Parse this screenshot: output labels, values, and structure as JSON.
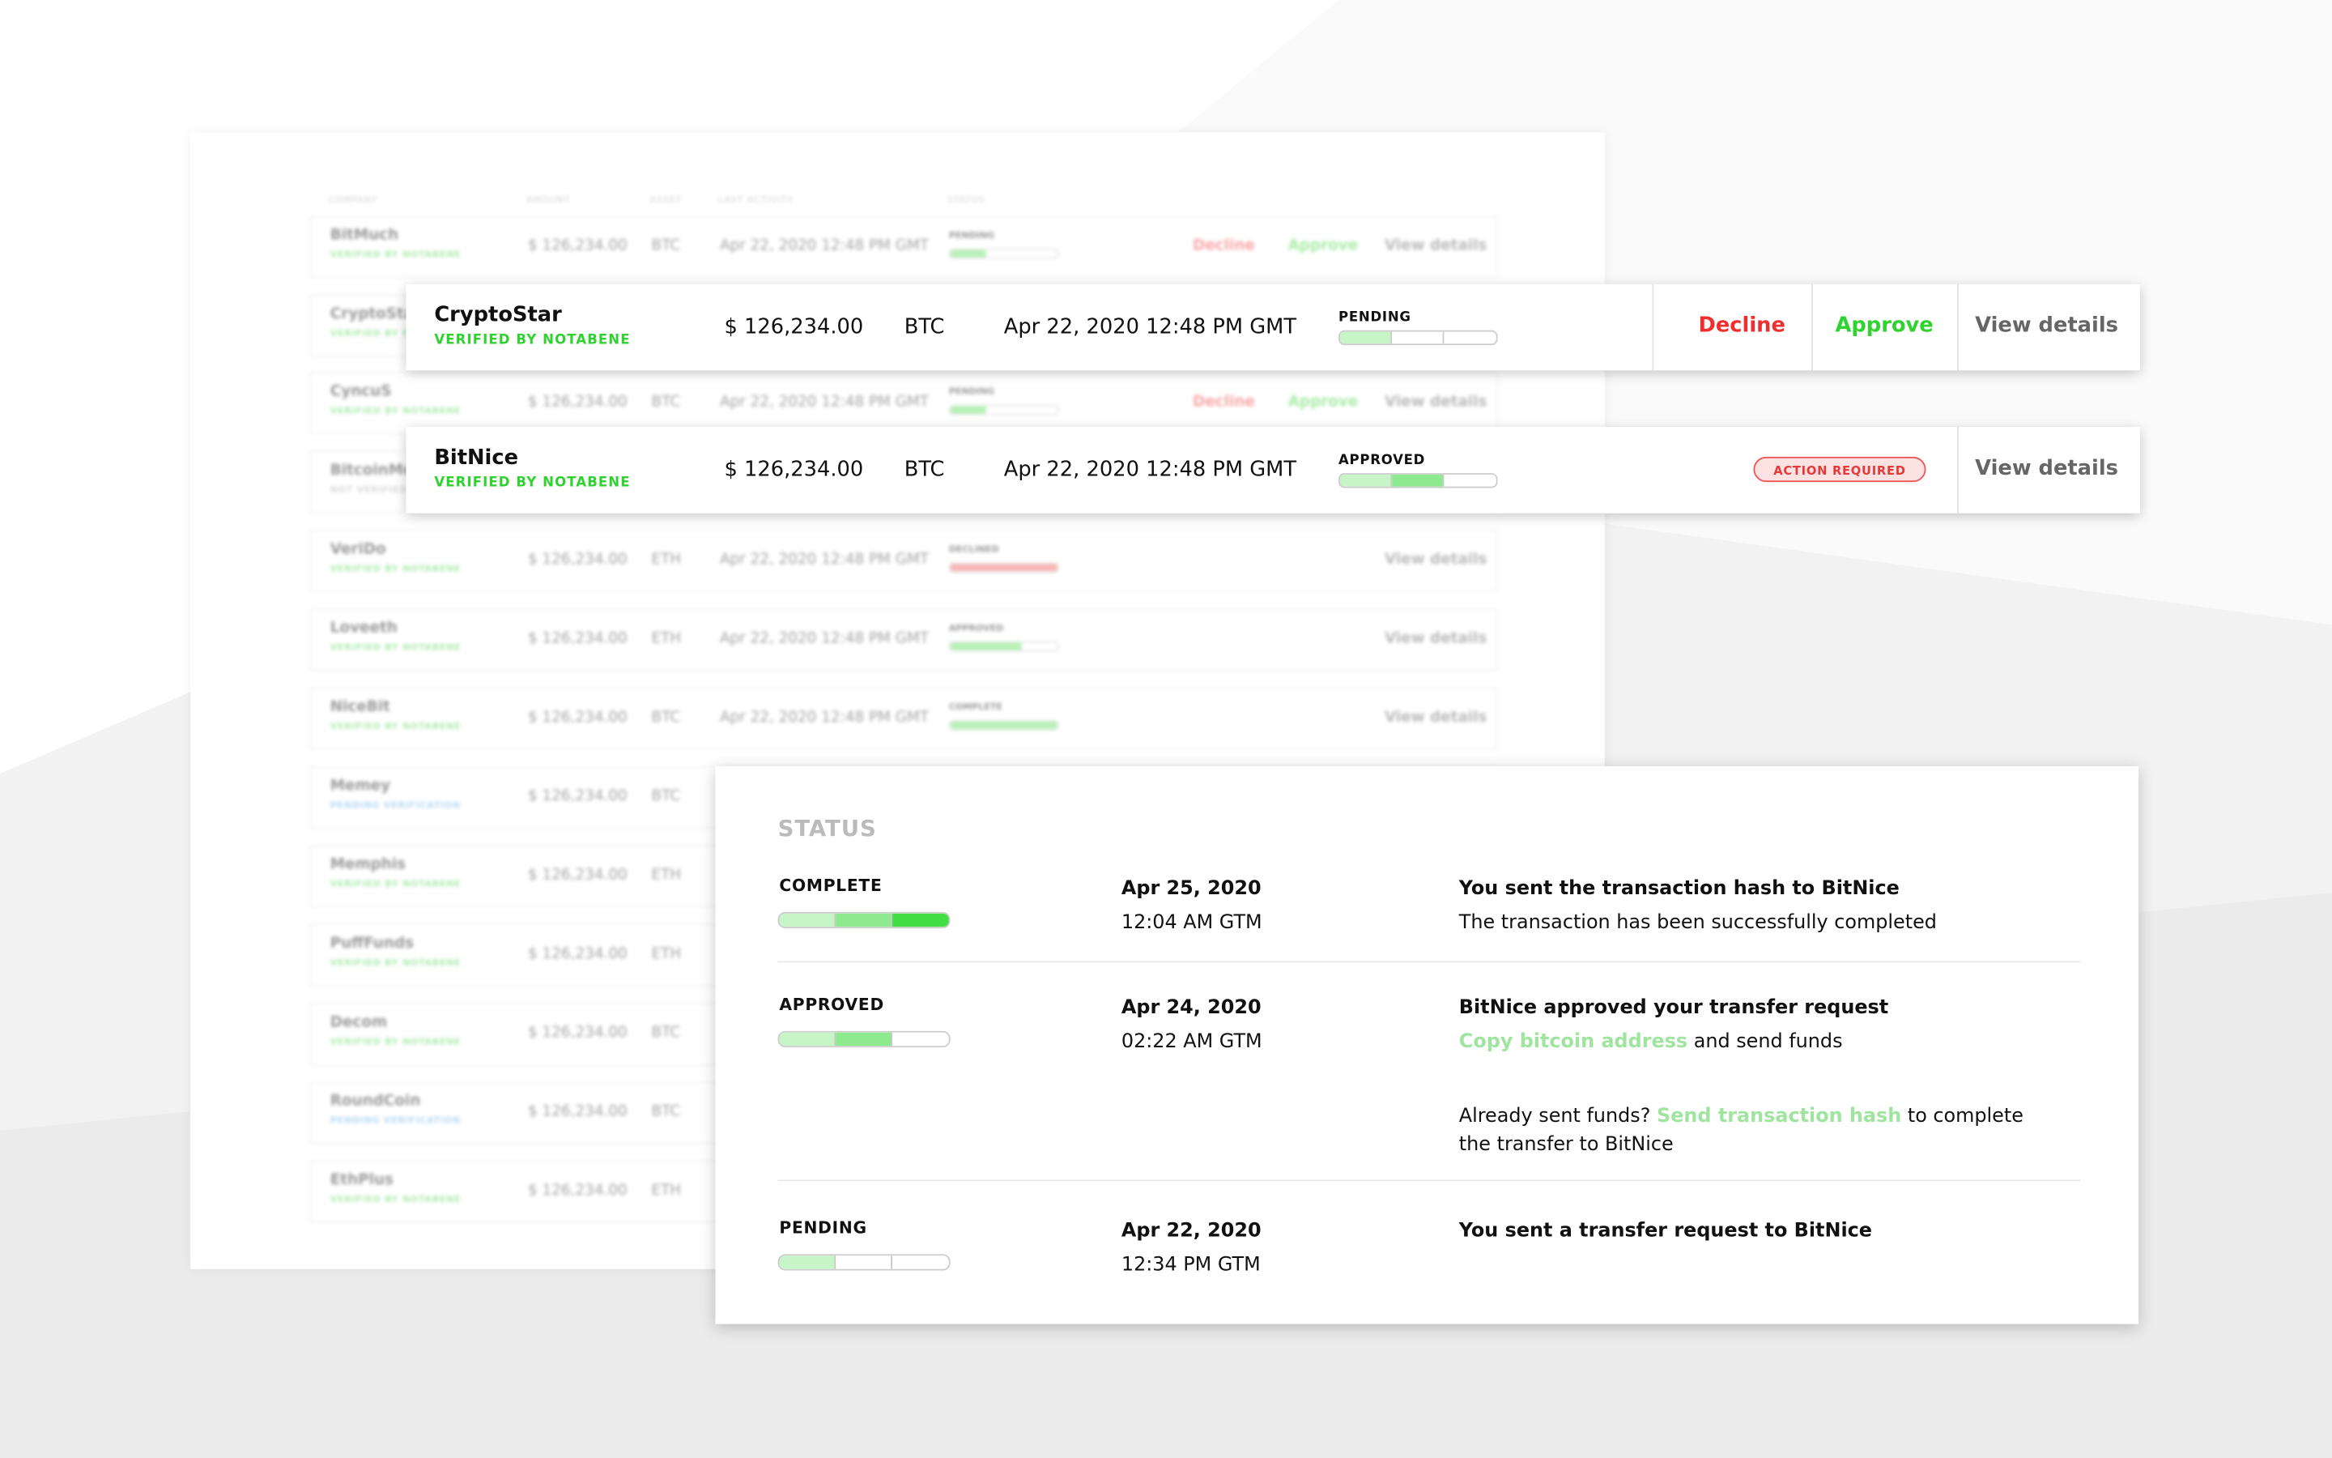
{
  "table": {
    "headers": [
      "COMPANY",
      "AMOUNT",
      "ASSET",
      "LAST ACTIVITY",
      "STATUS"
    ],
    "rows": [
      {
        "company": "BitMuch",
        "sub": "VERIFIED BY NOTABENE",
        "amount": "$ 126,234.00",
        "asset": "BTC",
        "date": "Apr 22, 2020 12:48 PM GMT",
        "status": "PENDING",
        "decline": "Decline",
        "approve": "Approve",
        "view": "View details"
      },
      {
        "company": "CryptoStar",
        "sub": "VERIFIED BY NOTABENE",
        "amount": "$ 126,234.00",
        "asset": "BTC",
        "date": "Apr 22, 2020 12:48 PM GMT",
        "status": "PENDING",
        "decline": "Decline",
        "approve": "Approve",
        "view": "View details"
      },
      {
        "company": "CyncuS",
        "sub": "VERIFIED BY NOTABENE",
        "amount": "$ 126,234.00",
        "asset": "BTC",
        "date": "Apr 22, 2020 12:48 PM GMT",
        "status": "PENDING",
        "decline": "Decline",
        "approve": "Approve",
        "view": "View details"
      },
      {
        "company": "BitcoinMe",
        "sub": "NOT VERIFIED",
        "amount": "$ 126,234.00",
        "asset": "BTC",
        "date": "Apr 22, 2020 12:48 PM GMT",
        "status": "APPROVED",
        "decline": "",
        "approve": "",
        "view": "View details"
      },
      {
        "company": "VeriDo",
        "sub": "VERIFIED BY NOTABENE",
        "amount": "$ 126,234.00",
        "asset": "ETH",
        "date": "Apr 22, 2020 12:48 PM GMT",
        "status": "DECLINED",
        "decline": "",
        "approve": "",
        "view": "View details"
      },
      {
        "company": "Loveeth",
        "sub": "VERIFIED BY NOTABENE",
        "amount": "$ 126,234.00",
        "asset": "ETH",
        "date": "Apr 22, 2020 12:48 PM GMT",
        "status": "APPROVED",
        "decline": "",
        "approve": "",
        "view": "View details"
      },
      {
        "company": "NiceBit",
        "sub": "VERIFIED BY NOTABENE",
        "amount": "$ 126,234.00",
        "asset": "BTC",
        "date": "Apr 22, 2020 12:48 PM GMT",
        "status": "COMPLETE",
        "decline": "",
        "approve": "",
        "view": "View details"
      },
      {
        "company": "Memey",
        "sub": "PENDING VERIFICATION",
        "amount": "$ 126,234.00",
        "asset": "BTC",
        "date": "",
        "status": "",
        "decline": "",
        "approve": "",
        "view": ""
      },
      {
        "company": "Memphis",
        "sub": "VERIFIED BY NOTABENE",
        "amount": "$ 126,234.00",
        "asset": "ETH",
        "date": "",
        "status": "",
        "decline": "",
        "approve": "",
        "view": ""
      },
      {
        "company": "PuffFunds",
        "sub": "VERIFIED BY NOTABENE",
        "amount": "$ 126,234.00",
        "asset": "ETH",
        "date": "",
        "status": "",
        "decline": "",
        "approve": "",
        "view": ""
      },
      {
        "company": "Decom",
        "sub": "VERIFIED BY NOTABENE",
        "amount": "$ 126,234.00",
        "asset": "BTC",
        "date": "",
        "status": "",
        "decline": "",
        "approve": "",
        "view": ""
      },
      {
        "company": "RoundCoin",
        "sub": "PENDING VERIFICATION",
        "amount": "$ 126,234.00",
        "asset": "BTC",
        "date": "",
        "status": "",
        "decline": "",
        "approve": "",
        "view": ""
      },
      {
        "company": "EthPlus",
        "sub": "VERIFIED BY NOTABENE",
        "amount": "$ 126,234.00",
        "asset": "ETH",
        "date": "",
        "status": "",
        "decline": "",
        "approve": "",
        "view": ""
      }
    ]
  },
  "row_cryptostar": {
    "company": "CryptoStar",
    "sub": "VERIFIED BY NOTABENE",
    "amount": "$ 126,234.00",
    "asset": "BTC",
    "date": "Apr 22, 2020 12:48 PM GMT",
    "status": "PENDING",
    "progress_steps_filled": 1,
    "decline": "Decline",
    "approve": "Approve",
    "view": "View details"
  },
  "row_bitnice": {
    "company": "BitNice",
    "sub": "VERIFIED BY NOTABENE",
    "amount": "$ 126,234.00",
    "asset": "BTC",
    "date": "Apr 22, 2020 12:48 PM GMT",
    "status": "APPROVED",
    "progress_steps_filled": 2,
    "badge": "ACTION REQUIRED",
    "view": "View details"
  },
  "status_panel": {
    "title": "STATUS",
    "complete": {
      "label": "COMPLETE",
      "steps_filled": 3,
      "date": "Apr 25, 2020",
      "time": "12:04 AM GTM",
      "heading": "You sent the transaction hash to BitNice",
      "line1": "The transaction has been successfully completed"
    },
    "approved": {
      "label": "APPROVED",
      "steps_filled": 2,
      "date": "Apr 24, 2020",
      "time": "02:22 AM GTM",
      "heading": "BitNice approved your transfer request",
      "link1": "Copy bitcoin address",
      "line1_rest": " and send funds",
      "line2_pre": "Already sent funds? ",
      "link2": "Send transaction hash",
      "line2_post": " to complete the transfer to BitNice"
    },
    "pending": {
      "label": "PENDING",
      "steps_filled": 1,
      "date": "Apr 22, 2020",
      "time": "12:34 PM GTM",
      "heading": "You sent a transfer request to BitNice"
    }
  },
  "colors": {
    "green": "#2fd22f",
    "red": "#ef2f2f",
    "link_green": "#9fe59f",
    "badge_bg": "#fde2e2"
  }
}
